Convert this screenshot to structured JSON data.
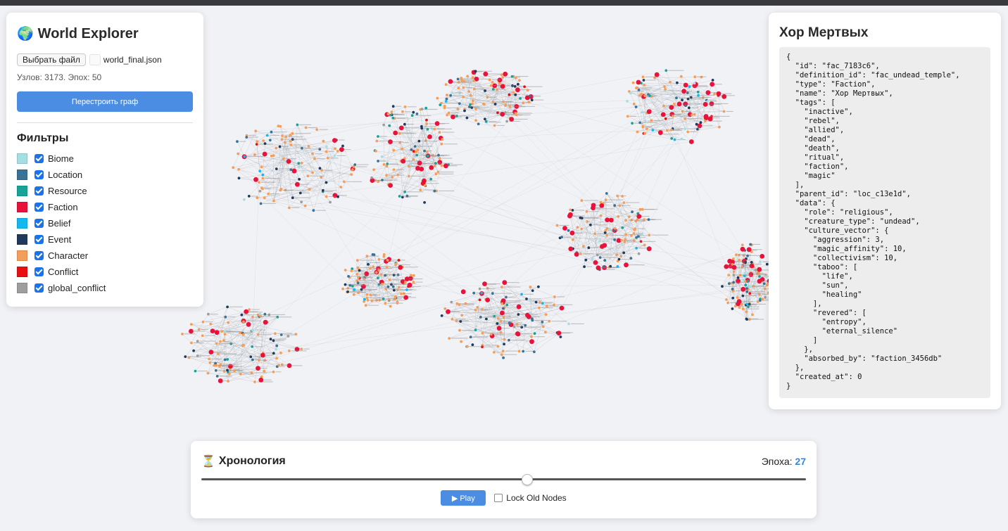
{
  "app": {
    "title": "World Explorer",
    "icon": "globe-icon"
  },
  "file": {
    "choose_label": "Выбрать файл",
    "filename": "world_final.json"
  },
  "stats": "Узлов: 3173. Эпох: 50",
  "rebuild_label": "Перестроить граф",
  "filters": {
    "title": "Фильтры",
    "items": [
      {
        "label": "Biome",
        "color": "#a6dfe3",
        "checked": true
      },
      {
        "label": "Location",
        "color": "#3a7295",
        "checked": true
      },
      {
        "label": "Resource",
        "color": "#17a398",
        "checked": true
      },
      {
        "label": "Faction",
        "color": "#e8123a",
        "checked": true
      },
      {
        "label": "Belief",
        "color": "#14b8f0",
        "checked": true
      },
      {
        "label": "Event",
        "color": "#1f3a5a",
        "checked": true
      },
      {
        "label": "Character",
        "color": "#f59e5a",
        "checked": true
      },
      {
        "label": "Conflict",
        "color": "#e80f0f",
        "checked": true
      },
      {
        "label": "global_conflict",
        "color": "#9e9e9e",
        "checked": true
      }
    ]
  },
  "detail": {
    "title": "Хор Мертвых",
    "json_text": "{\n  \"id\": \"fac_7183c6\",\n  \"definition_id\": \"fac_undead_temple\",\n  \"type\": \"Faction\",\n  \"name\": \"Хор Мертвых\",\n  \"tags\": [\n    \"inactive\",\n    \"rebel\",\n    \"allied\",\n    \"dead\",\n    \"death\",\n    \"ritual\",\n    \"faction\",\n    \"magic\"\n  ],\n  \"parent_id\": \"loc_c13e1d\",\n  \"data\": {\n    \"role\": \"religious\",\n    \"creature_type\": \"undead\",\n    \"culture_vector\": {\n      \"aggression\": 3,\n      \"magic_affinity\": 10,\n      \"collectivism\": 10,\n      \"taboo\": [\n        \"life\",\n        \"sun\",\n        \"healing\"\n      ],\n      \"revered\": [\n        \"entropy\",\n        \"eternal_silence\"\n      ]\n    },\n    \"absorbed_by\": \"faction_3456db\"\n  },\n  \"created_at\": 0\n}"
  },
  "timeline": {
    "title": "Хронология",
    "icon": "hourglass-icon",
    "epoch_label": "Эпоха:",
    "epoch_value": "27",
    "epoch_number": 27,
    "epoch_max": 50,
    "play_label": "▶ Play",
    "lock_label": "Lock Old Nodes",
    "lock_checked": false
  }
}
